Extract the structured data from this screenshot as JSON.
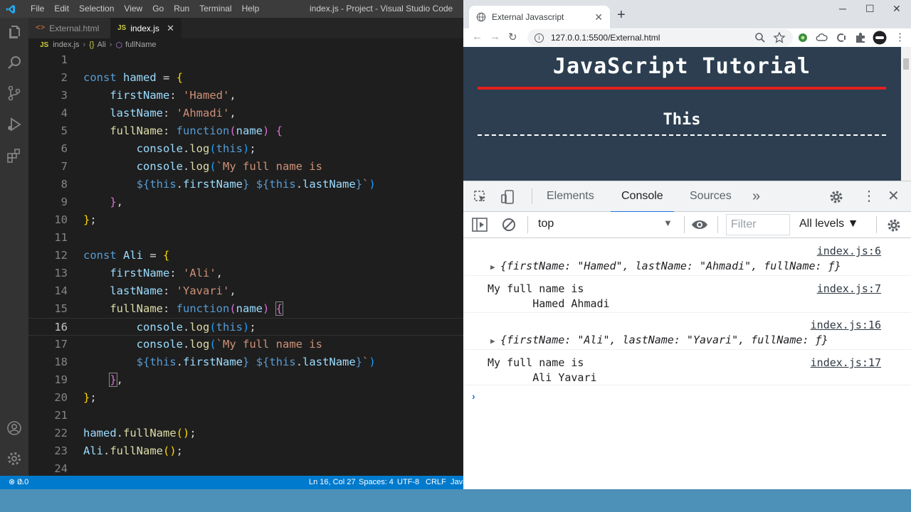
{
  "vscode": {
    "menu": [
      "File",
      "Edit",
      "Selection",
      "View",
      "Go",
      "Run",
      "Terminal",
      "Help"
    ],
    "window_title": "index.js - Project - Visual Studio Code",
    "tabs": [
      {
        "label": "External.html",
        "icon": "html-file-icon",
        "badge": "<>"
      },
      {
        "label": "index.js",
        "icon": "js-file-icon",
        "badge": "JS",
        "active": true
      }
    ],
    "breadcrumb": [
      "index.js",
      "Ali",
      "fullName"
    ],
    "breadcrumb_badges": [
      "JS",
      "{}"
    ],
    "active_line": 16,
    "status": {
      "errors": "0",
      "warnings": "0",
      "position": "Ln 16, Col 27",
      "spaces": "Spaces: 4",
      "encoding": "UTF-8",
      "eol": "CRLF",
      "language": "Java"
    },
    "colors": {
      "statusbar": "#007acc",
      "editor_bg": "#1e1e1e"
    }
  },
  "browser": {
    "tab_title": "External Javascript",
    "url": "127.0.0.1:5500/External.html",
    "page_title": "JavaScript Tutorial",
    "page_subtitle": "This",
    "colors": {
      "page_bg": "#2c3e50",
      "title_rule": "#e21f1f"
    }
  },
  "devtools": {
    "tabs": [
      "Elements",
      "Console",
      "Sources"
    ],
    "more": "»",
    "active_tab": "Console",
    "context": "top",
    "filter_placeholder": "Filter",
    "levels": "All levels ▼",
    "messages": [
      {
        "source": "index.js:6",
        "text": "{firstName: \"Hamed\", lastName: \"Ahmadi\", fullName: ƒ}",
        "kind": "object"
      },
      {
        "source": "index.js:7",
        "line1": "My full name is",
        "line2": "       Hamed Ahmadi",
        "kind": "log"
      },
      {
        "source": "index.js:16",
        "text": "{firstName: \"Ali\", lastName: \"Yavari\", fullName: ƒ}",
        "kind": "object"
      },
      {
        "source": "index.js:17",
        "line1": "My full name is",
        "line2": "       Ali Yavari",
        "kind": "log"
      }
    ],
    "prompt": "›"
  }
}
